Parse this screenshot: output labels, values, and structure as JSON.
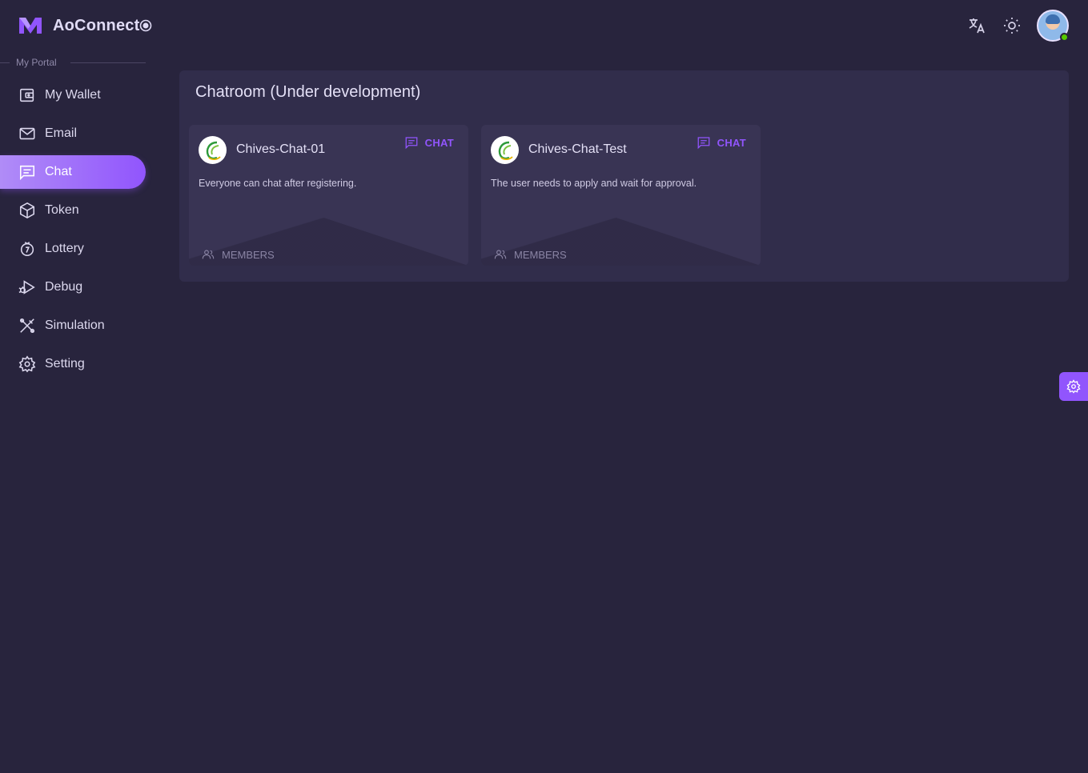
{
  "app": {
    "name": "AoConnect",
    "brand_color": "#9155FD"
  },
  "sidebar": {
    "section_label": "My Portal",
    "items": [
      {
        "label": "My Wallet",
        "icon": "wallet-icon"
      },
      {
        "label": "Email",
        "icon": "mail-icon"
      },
      {
        "label": "Chat",
        "icon": "chat-icon",
        "active": true
      },
      {
        "label": "Token",
        "icon": "token-icon"
      },
      {
        "label": "Lottery",
        "icon": "lottery-icon"
      },
      {
        "label": "Debug",
        "icon": "debug-icon"
      },
      {
        "label": "Simulation",
        "icon": "simulation-icon"
      },
      {
        "label": "Setting",
        "icon": "settings-icon"
      }
    ]
  },
  "topbar": {
    "icons": [
      "translate-icon",
      "brightness-icon"
    ],
    "user_status": "online"
  },
  "main": {
    "title": "Chatroom (Under development)",
    "chatrooms": [
      {
        "name": "Chives-Chat-01",
        "description": "Everyone can chat after registering.",
        "action_label": "CHAT",
        "members_label": "MEMBERS"
      },
      {
        "name": "Chives-Chat-Test",
        "description": "The user needs to apply and wait for approval.",
        "action_label": "CHAT",
        "members_label": "MEMBERS"
      }
    ]
  }
}
